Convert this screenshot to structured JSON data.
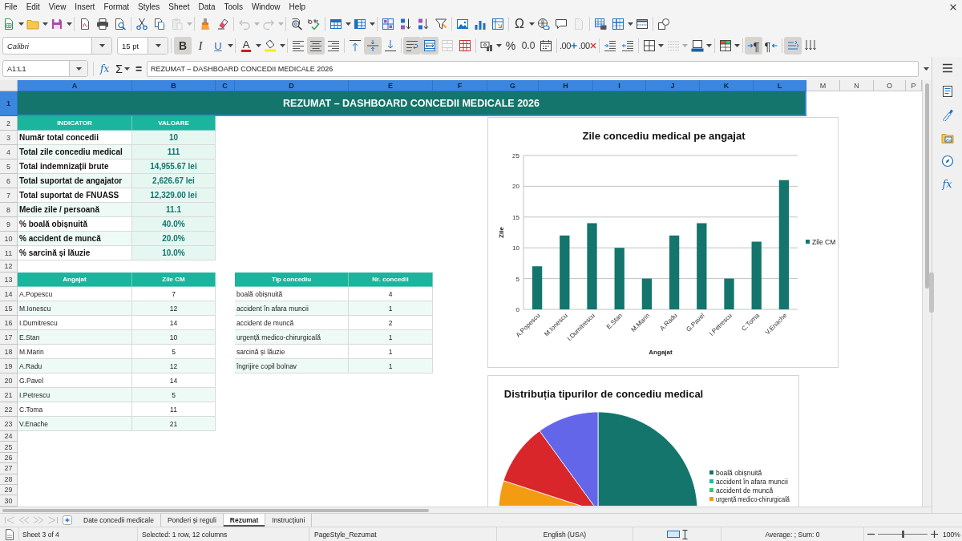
{
  "menu_bar": [
    "File",
    "Edit",
    "View",
    "Insert",
    "Format",
    "Styles",
    "Sheet",
    "Data",
    "Tools",
    "Window",
    "Help"
  ],
  "standard_toolbar": [
    {
      "kind": "new",
      "disabled": false
    },
    {
      "kind": "open",
      "disabled": false
    },
    {
      "kind": "save",
      "disabled": false
    },
    {
      "kind": "pdf",
      "disabled": false
    },
    {
      "kind": "print",
      "disabled": false
    },
    {
      "kind": "preview",
      "disabled": false
    },
    {
      "kind": "cut",
      "disabled": false
    },
    {
      "kind": "copy",
      "disabled": false
    },
    {
      "kind": "paste",
      "disabled": true
    },
    {
      "kind": "clone",
      "disabled": false
    },
    {
      "kind": "clear",
      "disabled": false
    },
    {
      "kind": "undo",
      "disabled": true
    },
    {
      "kind": "redo",
      "disabled": true
    },
    {
      "kind": "find",
      "disabled": false
    },
    {
      "kind": "spelling",
      "disabled": false
    },
    {
      "kind": "row",
      "disabled": false
    },
    {
      "kind": "column",
      "disabled": false
    },
    {
      "kind": "sort",
      "disabled": false
    },
    {
      "kind": "sort_ascending",
      "disabled": false
    },
    {
      "kind": "sort_descending",
      "disabled": false
    },
    {
      "kind": "autofilter",
      "disabled": false
    },
    {
      "kind": "image",
      "disabled": false
    },
    {
      "kind": "chart",
      "disabled": false
    },
    {
      "kind": "pivot_table",
      "disabled": false
    },
    {
      "kind": "special_character",
      "glyph": "Ω",
      "disabled": false
    },
    {
      "kind": "hyperlink",
      "disabled": false
    },
    {
      "kind": "comment",
      "disabled": false
    },
    {
      "kind": "header_footer",
      "disabled": true
    },
    {
      "kind": "print_area",
      "disabled": false
    },
    {
      "kind": "freeze",
      "disabled": false
    },
    {
      "kind": "split_window",
      "disabled": false
    },
    {
      "kind": "draw_functions",
      "disabled": false
    }
  ],
  "formatting_toolbar": {
    "font_name": "Calibri",
    "font_size": "15 pt",
    "buttons": [
      {
        "kind": "bold",
        "glyph": "B",
        "pressed": true,
        "disabled": false
      },
      {
        "kind": "italic",
        "glyph": "I",
        "pressed": false,
        "disabled": false
      },
      {
        "kind": "underline",
        "glyph": "U",
        "pressed": false,
        "disabled": false
      },
      {
        "kind": "font_color",
        "glyph": "A",
        "pressed": false,
        "disabled": false
      },
      {
        "kind": "highlight",
        "pressed": false,
        "disabled": false
      },
      {
        "kind": "align_left",
        "pressed": false,
        "disabled": false
      },
      {
        "kind": "align_center",
        "pressed": true,
        "disabled": false
      },
      {
        "kind": "align_right",
        "pressed": false,
        "disabled": false
      },
      {
        "kind": "align_top",
        "pressed": false,
        "disabled": false
      },
      {
        "kind": "align_middle",
        "pressed": true,
        "disabled": false
      },
      {
        "kind": "align_bottom",
        "pressed": false,
        "disabled": false
      },
      {
        "kind": "wrap_text",
        "pressed": true,
        "disabled": false
      },
      {
        "kind": "merge_center",
        "pressed": true,
        "disabled": false
      },
      {
        "kind": "merge",
        "pressed": false,
        "disabled": true
      },
      {
        "kind": "unmerge",
        "pressed": false,
        "disabled": false
      },
      {
        "kind": "currency",
        "pressed": false,
        "disabled": false
      },
      {
        "kind": "percent",
        "glyph": "%",
        "pressed": false,
        "disabled": false
      },
      {
        "kind": "number",
        "glyph": "0.0",
        "pressed": false,
        "disabled": false
      },
      {
        "kind": "date",
        "pressed": false,
        "disabled": false
      },
      {
        "kind": "add_decimal",
        "glyph": ".00",
        "pressed": false,
        "disabled": false
      },
      {
        "kind": "delete_decimal",
        "glyph": ".00",
        "pressed": false,
        "disabled": false
      },
      {
        "kind": "indent",
        "pressed": false,
        "disabled": false
      },
      {
        "kind": "outdent",
        "pressed": false,
        "disabled": false
      },
      {
        "kind": "borders",
        "pressed": false,
        "disabled": false
      },
      {
        "kind": "border_style",
        "pressed": false,
        "disabled": true
      },
      {
        "kind": "border_color",
        "pressed": false,
        "disabled": false
      },
      {
        "kind": "conditional",
        "pressed": false,
        "disabled": false
      },
      {
        "kind": "paragraph_ltr",
        "glyph": "¶",
        "pressed": true,
        "disabled": false
      },
      {
        "kind": "paragraph_rtl",
        "glyph": "¶",
        "pressed": false,
        "disabled": false
      },
      {
        "kind": "text_ltr",
        "pressed": true,
        "disabled": false
      },
      {
        "kind": "text_ttb",
        "pressed": false,
        "disabled": false
      }
    ]
  },
  "formula_bar": {
    "name_box": "A1:L1",
    "buttons": [
      {
        "kind": "function_wizard",
        "glyph": "fx"
      },
      {
        "kind": "sum",
        "glyph": "Σ"
      },
      {
        "kind": "formula",
        "glyph": "="
      }
    ],
    "content": "REZUMAT – DASHBOARD CONCEDII MEDICALE 2026"
  },
  "sheet": {
    "columns": [
      {
        "label": "A",
        "selected": true
      },
      {
        "label": "B",
        "selected": true
      },
      {
        "label": "C",
        "selected": true
      },
      {
        "label": "D",
        "selected": true
      },
      {
        "label": "E",
        "selected": true
      },
      {
        "label": "F",
        "selected": true
      },
      {
        "label": "G",
        "selected": true
      },
      {
        "label": "H",
        "selected": true
      },
      {
        "label": "I",
        "selected": true
      },
      {
        "label": "J",
        "selected": true
      },
      {
        "label": "K",
        "selected": true
      },
      {
        "label": "L",
        "selected": true
      },
      {
        "label": "M",
        "selected": false
      },
      {
        "label": "N",
        "selected": false
      },
      {
        "label": "O",
        "selected": false
      },
      {
        "label": "P",
        "selected": false
      }
    ],
    "rows": [
      {
        "label": "1",
        "selected": true
      },
      {
        "label": "2",
        "selected": false
      },
      {
        "label": "3",
        "selected": false
      },
      {
        "label": "4",
        "selected": false
      },
      {
        "label": "5",
        "selected": false
      },
      {
        "label": "6",
        "selected": false
      },
      {
        "label": "7",
        "selected": false
      },
      {
        "label": "8",
        "selected": false
      },
      {
        "label": "9",
        "selected": false
      },
      {
        "label": "10",
        "selected": false
      },
      {
        "label": "11",
        "selected": false
      },
      {
        "label": "12",
        "selected": false
      },
      {
        "label": "13",
        "selected": false
      },
      {
        "label": "14",
        "selected": false
      },
      {
        "label": "15",
        "selected": false
      },
      {
        "label": "16",
        "selected": false
      },
      {
        "label": "17",
        "selected": false
      },
      {
        "label": "18",
        "selected": false
      },
      {
        "label": "19",
        "selected": false
      },
      {
        "label": "20",
        "selected": false
      },
      {
        "label": "21",
        "selected": false
      },
      {
        "label": "22",
        "selected": false
      },
      {
        "label": "23",
        "selected": false
      },
      {
        "label": "24",
        "selected": false
      },
      {
        "label": "25",
        "selected": false
      },
      {
        "label": "26",
        "selected": false
      },
      {
        "label": "27",
        "selected": false
      },
      {
        "label": "28",
        "selected": false
      },
      {
        "label": "29",
        "selected": false
      },
      {
        "label": "30",
        "selected": false
      }
    ],
    "title": "REZUMAT – DASHBOARD CONCEDII MEDICALE 2026",
    "summary": {
      "columns": [
        "INDICATOR",
        "VALOARE"
      ],
      "rows": [
        [
          "Număr total concedii",
          "10"
        ],
        [
          "Total zile concediu medical",
          "111"
        ],
        [
          "Total indemnizații brute",
          "14,955.67 lei"
        ],
        [
          "Total suportat de angajator",
          "2,626.67 lei"
        ],
        [
          "Total suportat de FNUASS",
          "12,329.00 lei"
        ],
        [
          "Medie zile / persoană",
          "11.1"
        ],
        [
          "% boală obișnuită",
          "40.0%"
        ],
        [
          "% accident de muncă",
          "20.0%"
        ],
        [
          "% sarcină și lăuzie",
          "10.0%"
        ]
      ]
    },
    "employees": {
      "columns": [
        "Angajat",
        "Zile CM"
      ],
      "rows": [
        [
          "A.Popescu",
          "7"
        ],
        [
          "M.Ionescu",
          "12"
        ],
        [
          "I.Dumitrescu",
          "14"
        ],
        [
          "E.Stan",
          "10"
        ],
        [
          "M.Marin",
          "5"
        ],
        [
          "A.Radu",
          "12"
        ],
        [
          "G.Pavel",
          "14"
        ],
        [
          "I.Petrescu",
          "5"
        ],
        [
          "C.Toma",
          "11"
        ],
        [
          "V.Enache",
          "21"
        ]
      ]
    },
    "leave_types": {
      "columns": [
        "Tip concediu",
        "Nr. concedii"
      ],
      "rows": [
        [
          "boală obișnuită",
          "4"
        ],
        [
          "accident în afara muncii",
          "1"
        ],
        [
          "accident de muncă",
          "2"
        ],
        [
          "urgență medico-chirurgicală",
          "1"
        ],
        [
          "sarcină și lăuzie",
          "1"
        ],
        [
          "îngrijire copil bolnav",
          "1"
        ]
      ]
    },
    "bar_chart": {
      "chart_data": {
        "type": "bar",
        "title": "Zile concediu medical pe angajat",
        "xlabel": "Angajat",
        "ylabel": "Zile",
        "categories": [
          "A.Popescu",
          "M.Ionescu",
          "I.Dumitrescu",
          "E.Stan",
          "M.Marin",
          "A.Radu",
          "G.Pavel",
          "I.Petrescu",
          "C.Toma",
          "V.Enache"
        ],
        "series": [
          {
            "name": "Zile CM",
            "color": "#13756b",
            "values": [
              7,
              12,
              14,
              10,
              5,
              12,
              14,
              5,
              11,
              21
            ]
          }
        ],
        "ylim": [
          0,
          25
        ],
        "yticks": [
          {
            "value": 0,
            "label": "0"
          },
          {
            "value": 5,
            "label": "5"
          },
          {
            "value": 10,
            "label": "10"
          },
          {
            "value": 15,
            "label": "15"
          },
          {
            "value": 20,
            "label": "20"
          },
          {
            "value": 25,
            "label": "25"
          }
        ],
        "grid": true,
        "legend": "right"
      }
    },
    "pie_chart": {
      "title": "Distribuția tipurilor de concediu medical",
      "legend": [
        {
          "label": "boală obișnuită",
          "color": "#13756b"
        },
        {
          "label": "accident în afara muncii",
          "color": "#1abc9c"
        },
        {
          "label": "accident de muncă",
          "color": "#2ecc71"
        },
        {
          "label": "urgență medico-chirurgicală",
          "color": "#f39c12"
        }
      ]
    }
  },
  "sidebar": {
    "buttons": [
      {
        "kind": "properties"
      },
      {
        "kind": "styles"
      },
      {
        "kind": "gallery"
      },
      {
        "kind": "navigator"
      },
      {
        "kind": "functions",
        "glyph": "fx"
      }
    ]
  },
  "sheet_nav": [
    {
      "kind": "first",
      "disabled": true
    },
    {
      "kind": "previous",
      "disabled": true
    },
    {
      "kind": "next",
      "disabled": true
    },
    {
      "kind": "last",
      "disabled": true
    }
  ],
  "sheet_tabs": [
    {
      "label": "Date concedii medicale",
      "selected": false
    },
    {
      "label": "Ponderi și reguli",
      "selected": false
    },
    {
      "label": "Rezumat",
      "selected": true
    },
    {
      "label": "Instrucțiuni",
      "selected": false
    }
  ],
  "status_bar": {
    "sheet": "Sheet 3 of 4",
    "selection": "Selected: 1 row, 12 columns",
    "page_style": "PageStyle_Rezumat",
    "language": "English (USA)",
    "summary": "Average: ; Sum: 0",
    "zoom": {
      "level": 0.5,
      "value": "100%"
    }
  }
}
